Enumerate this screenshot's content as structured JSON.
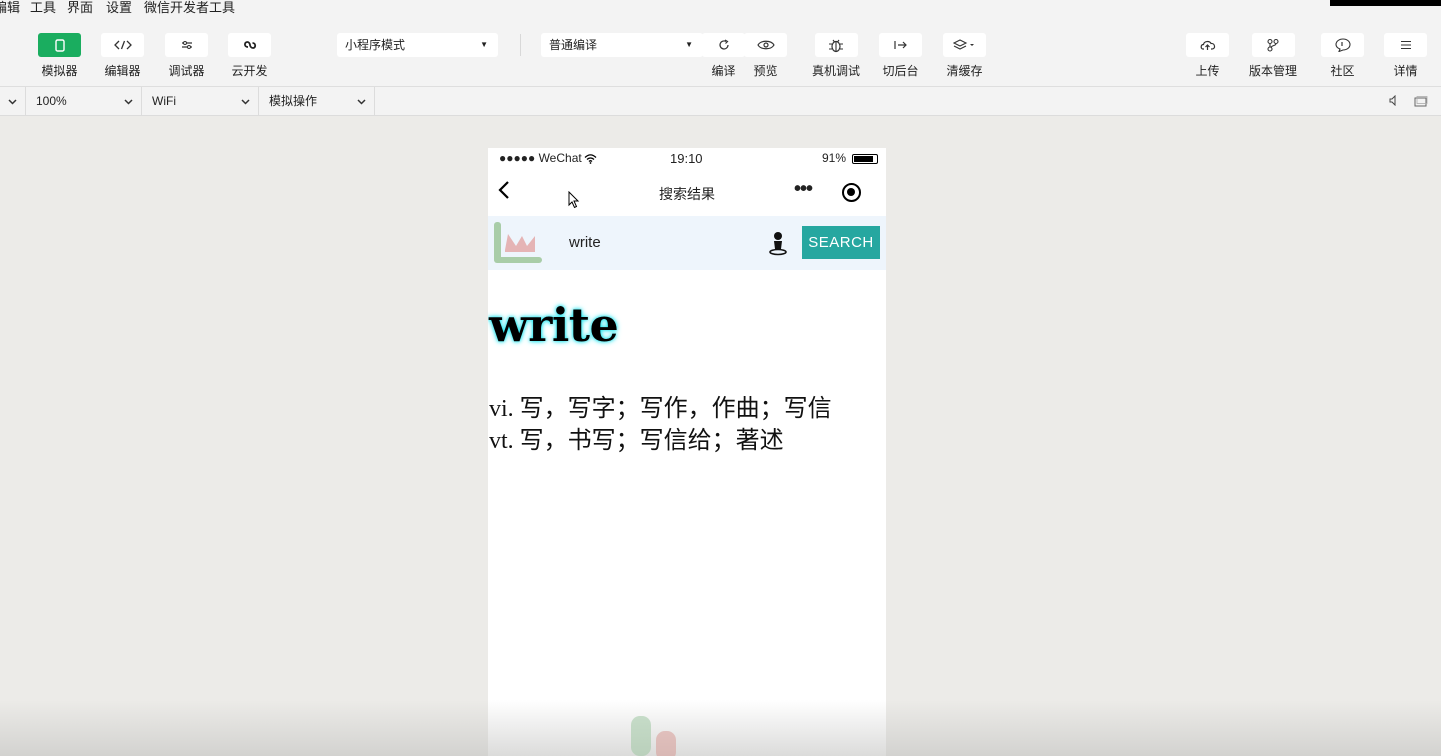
{
  "menu": [
    "编辑",
    "工具",
    "界面",
    "设置",
    "微信开发者工具"
  ],
  "toolbar": {
    "left_buttons": [
      {
        "label": "模拟器",
        "icon": "phone-icon",
        "active": true
      },
      {
        "label": "编辑器",
        "icon": "code-icon"
      },
      {
        "label": "调试器",
        "icon": "debug-sliders-icon"
      },
      {
        "label": "云开发",
        "icon": "cloud-link-icon"
      }
    ],
    "mode_select": "小程序模式",
    "compile_select": "普通编译",
    "mid_buttons": [
      {
        "label": "编译",
        "icon": "refresh-icon"
      },
      {
        "label": "预览",
        "icon": "eye-icon"
      },
      {
        "label": "真机调试",
        "icon": "bug-icon"
      },
      {
        "label": "切后台",
        "icon": "switch-background-icon"
      },
      {
        "label": "清缓存",
        "icon": "layers-icon"
      }
    ],
    "right_buttons": [
      {
        "label": "上传",
        "icon": "cloud-upload-icon"
      },
      {
        "label": "版本管理",
        "icon": "branch-icon"
      },
      {
        "label": "社区",
        "icon": "chat-bubble-icon"
      },
      {
        "label": "详情",
        "icon": "menu-lines-icon"
      }
    ]
  },
  "subbar": {
    "zoom": "100%",
    "network": "WiFi",
    "operation": "模拟操作"
  },
  "phone": {
    "status": {
      "carrier": "●●●●● WeChat",
      "time": "19:10",
      "battery": "91%"
    },
    "nav_title": "搜索结果",
    "search": {
      "query": "write",
      "button": "SEARCH"
    },
    "word": "write",
    "definitions": [
      "vi. 写，写字；写作，作曲；写信",
      "vt. 写，书写；写信给；著述"
    ]
  },
  "colors": {
    "accent_green": "#1aad5f",
    "search_button": "#26a7a0",
    "word_glow": "#22e6f0"
  }
}
